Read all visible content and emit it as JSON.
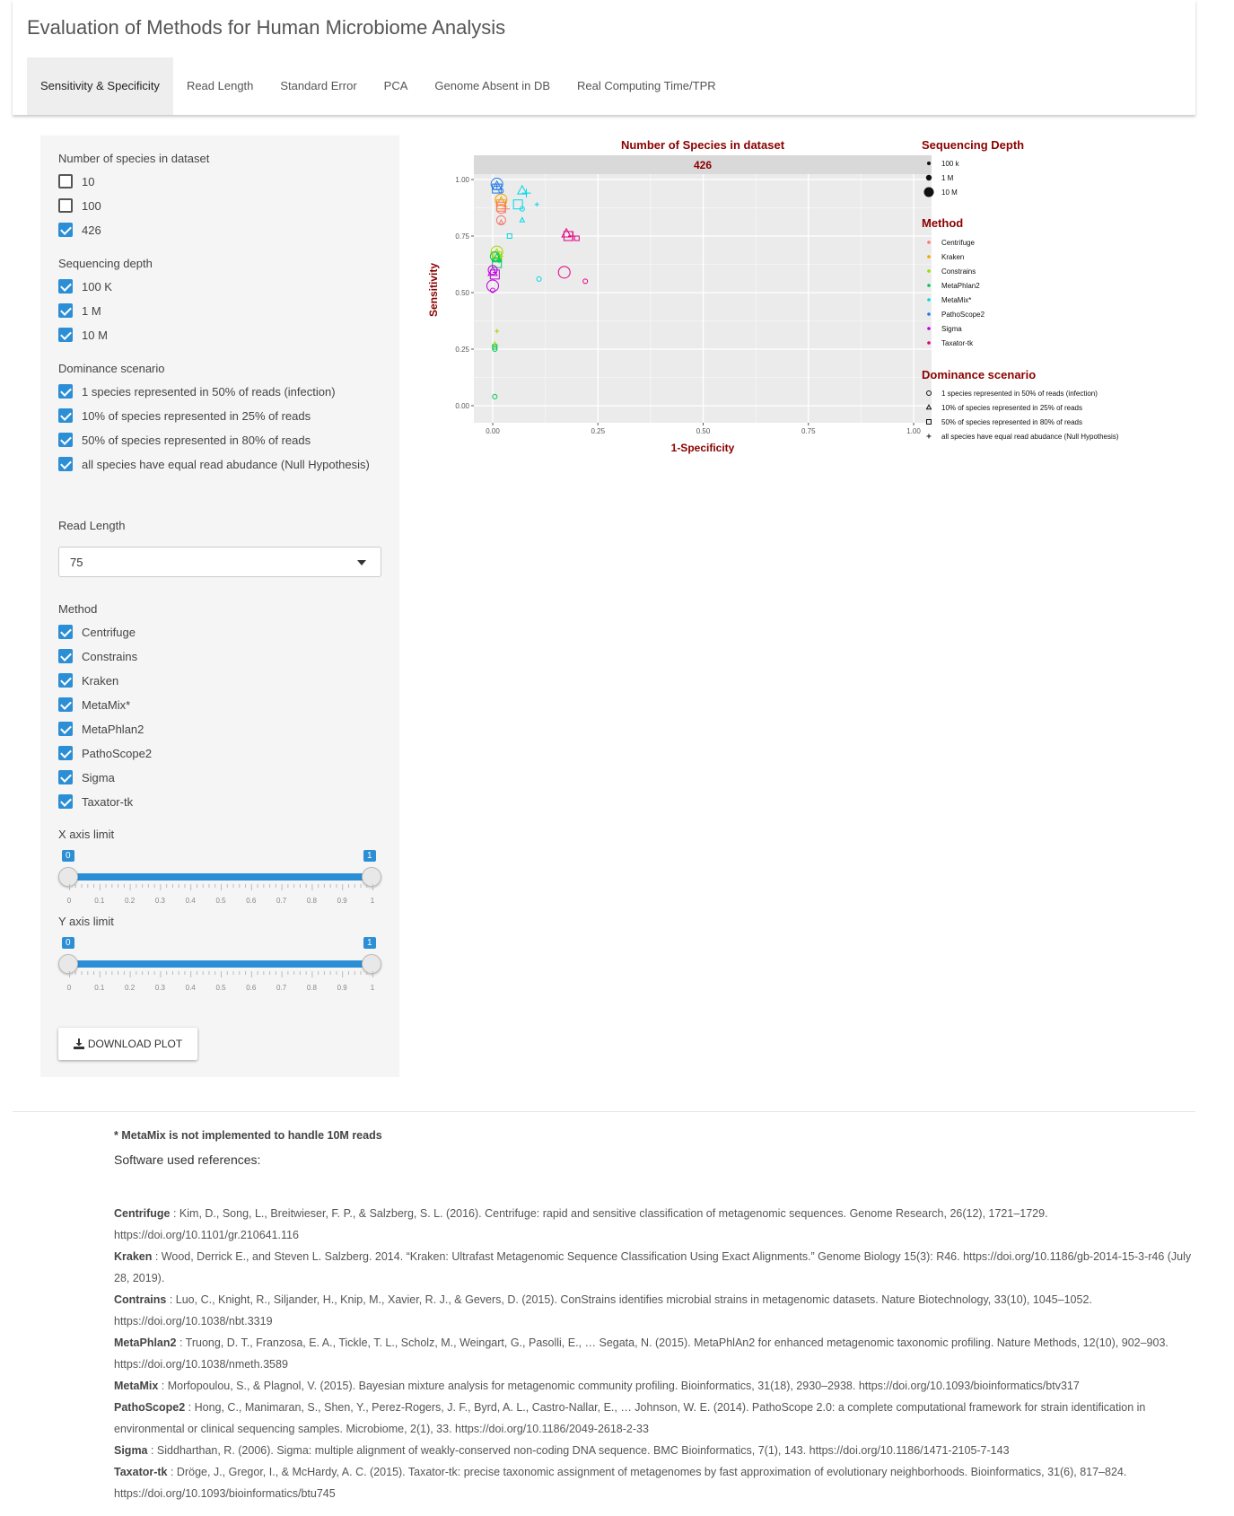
{
  "app": {
    "title": "Evaluation of Methods for Human Microbiome Analysis",
    "tabs": [
      {
        "label": "Sensitivity & Specificity",
        "active": true
      },
      {
        "label": "Read Length"
      },
      {
        "label": "Standard Error"
      },
      {
        "label": "PCA"
      },
      {
        "label": "Genome Absent in DB"
      },
      {
        "label": "Real Computing Time/TPR"
      }
    ]
  },
  "sidebar": {
    "species": {
      "label": "Number of species in dataset",
      "options": [
        {
          "label": "10",
          "checked": false
        },
        {
          "label": "100",
          "checked": false
        },
        {
          "label": "426",
          "checked": true
        }
      ]
    },
    "depth": {
      "label": "Sequencing depth",
      "options": [
        {
          "label": "100 K",
          "checked": true
        },
        {
          "label": "1 M",
          "checked": true
        },
        {
          "label": "10 M",
          "checked": true
        }
      ]
    },
    "dominance": {
      "label": "Dominance scenario",
      "options": [
        {
          "label": "1 species represented in 50% of reads (infection)",
          "checked": true
        },
        {
          "label": "10% of species represented in 25% of reads",
          "checked": true
        },
        {
          "label": "50% of species represented in 80% of reads",
          "checked": true
        },
        {
          "label": "all species have equal read abudance (Null Hypothesis)",
          "checked": true
        }
      ]
    },
    "read_length": {
      "label": "Read Length",
      "value": "75"
    },
    "method": {
      "label": "Method",
      "options": [
        {
          "label": "Centrifuge",
          "checked": true
        },
        {
          "label": "Constrains",
          "checked": true
        },
        {
          "label": "Kraken",
          "checked": true
        },
        {
          "label": "MetaMix*",
          "checked": true
        },
        {
          "label": "MetaPhlan2",
          "checked": true
        },
        {
          "label": "PathoScope2",
          "checked": true
        },
        {
          "label": "Sigma",
          "checked": true
        },
        {
          "label": "Taxator-tk",
          "checked": true
        }
      ]
    },
    "x_limit": {
      "label": "X axis limit",
      "min": "0",
      "max": "1",
      "ticks": [
        "0",
        "0.1",
        "0.2",
        "0.3",
        "0.4",
        "0.5",
        "0.6",
        "0.7",
        "0.8",
        "0.9",
        "1"
      ]
    },
    "y_limit": {
      "label": "Y axis limit",
      "min": "0",
      "max": "1",
      "ticks": [
        "0",
        "0.1",
        "0.2",
        "0.3",
        "0.4",
        "0.5",
        "0.6",
        "0.7",
        "0.8",
        "0.9",
        "1"
      ]
    },
    "download_label": "DOWNLOAD PLOT",
    "accent": "#2c8fd6"
  },
  "chart_data": {
    "type": "scatter",
    "title": "Number of Species in dataset",
    "facet_label": "426",
    "xlabel": "1-Specificity",
    "ylabel": "Sensitivity",
    "xlim": [
      0,
      1
    ],
    "ylim": [
      0,
      1
    ],
    "x_ticks": [
      "0.00",
      "0.25",
      "0.50",
      "0.75",
      "1.00"
    ],
    "y_ticks": [
      "0.00",
      "0.25",
      "0.50",
      "0.75",
      "1.00"
    ],
    "grid": true,
    "legend_position": "right",
    "legends": {
      "depth": {
        "title": "Sequencing Depth",
        "items": [
          "100 k",
          "1 M",
          "10 M"
        ]
      },
      "method": {
        "title": "Method",
        "items": [
          {
            "name": "Centrifuge",
            "color": "#f8766d"
          },
          {
            "name": "Kraken",
            "color": "#f5a300"
          },
          {
            "name": "Constrains",
            "color": "#a3d800"
          },
          {
            "name": "MetaPhlan2",
            "color": "#00c853"
          },
          {
            "name": "MetaMix*",
            "color": "#00d8e8"
          },
          {
            "name": "PathoScope2",
            "color": "#1e78e8"
          },
          {
            "name": "Sigma",
            "color": "#c000e0"
          },
          {
            "name": "Taxator-tk",
            "color": "#e0007f"
          }
        ]
      },
      "scenario": {
        "title": "Dominance scenario",
        "items": [
          {
            "name": "1 species represented in 50% of reads (infection)",
            "shape": "circle"
          },
          {
            "name": "10% of species represented in 25% of reads",
            "shape": "triangle"
          },
          {
            "name": "50% of species represented in 80% of reads",
            "shape": "square"
          },
          {
            "name": "all species have equal read abudance (Null Hypothesis)",
            "shape": "plus"
          }
        ]
      }
    },
    "points": [
      {
        "method": "PathoScope2",
        "shape": "circle",
        "size": 3,
        "x": 0.01,
        "y": 0.98
      },
      {
        "method": "PathoScope2",
        "shape": "triangle",
        "size": 2,
        "x": 0.01,
        "y": 0.97
      },
      {
        "method": "PathoScope2",
        "shape": "square",
        "size": 2,
        "x": 0.01,
        "y": 0.96
      },
      {
        "method": "PathoScope2",
        "shape": "plus",
        "size": 1,
        "x": 0.01,
        "y": 0.97
      },
      {
        "method": "PathoScope2",
        "shape": "circle",
        "size": 1,
        "x": 0.02,
        "y": 0.95
      },
      {
        "method": "Kraken",
        "shape": "circle",
        "size": 3,
        "x": 0.02,
        "y": 0.91
      },
      {
        "method": "Kraken",
        "shape": "triangle",
        "size": 2,
        "x": 0.02,
        "y": 0.9
      },
      {
        "method": "Kraken",
        "shape": "square",
        "size": 2,
        "x": 0.02,
        "y": 0.89
      },
      {
        "method": "Kraken",
        "shape": "plus",
        "size": 1,
        "x": 0.03,
        "y": 0.88
      },
      {
        "method": "Centrifuge",
        "shape": "circle",
        "size": 2,
        "x": 0.02,
        "y": 0.87
      },
      {
        "method": "Centrifuge",
        "shape": "square",
        "size": 2,
        "x": 0.02,
        "y": 0.88
      },
      {
        "method": "Centrifuge",
        "shape": "plus",
        "size": 2,
        "x": 0.03,
        "y": 0.87
      },
      {
        "method": "Centrifuge",
        "shape": "circle",
        "size": 2,
        "x": 0.02,
        "y": 0.82
      },
      {
        "method": "Centrifuge",
        "shape": "triangle",
        "size": 1,
        "x": 0.02,
        "y": 0.81
      },
      {
        "method": "MetaMix*",
        "shape": "triangle",
        "size": 2,
        "x": 0.07,
        "y": 0.95
      },
      {
        "method": "MetaMix*",
        "shape": "plus",
        "size": 2,
        "x": 0.08,
        "y": 0.94
      },
      {
        "method": "MetaMix*",
        "shape": "square",
        "size": 2,
        "x": 0.06,
        "y": 0.89
      },
      {
        "method": "MetaMix*",
        "shape": "circle",
        "size": 1,
        "x": 0.07,
        "y": 0.87
      },
      {
        "method": "MetaMix*",
        "shape": "plus",
        "size": 1,
        "x": 0.105,
        "y": 0.89
      },
      {
        "method": "MetaMix*",
        "shape": "triangle",
        "size": 1,
        "x": 0.07,
        "y": 0.82
      },
      {
        "method": "MetaMix*",
        "shape": "square",
        "size": 1,
        "x": 0.04,
        "y": 0.75
      },
      {
        "method": "MetaMix*",
        "shape": "circle",
        "size": 1,
        "x": 0.11,
        "y": 0.56
      },
      {
        "method": "Taxator-tk",
        "shape": "triangle",
        "size": 2,
        "x": 0.175,
        "y": 0.76
      },
      {
        "method": "Taxator-tk",
        "shape": "square",
        "size": 2,
        "x": 0.18,
        "y": 0.75
      },
      {
        "method": "Taxator-tk",
        "shape": "plus",
        "size": 2,
        "x": 0.19,
        "y": 0.75
      },
      {
        "method": "Taxator-tk",
        "shape": "square",
        "size": 1,
        "x": 0.2,
        "y": 0.74
      },
      {
        "method": "Taxator-tk",
        "shape": "circle",
        "size": 3,
        "x": 0.17,
        "y": 0.59
      },
      {
        "method": "Taxator-tk",
        "shape": "circle",
        "size": 1,
        "x": 0.22,
        "y": 0.55
      },
      {
        "method": "Constrains",
        "shape": "circle",
        "size": 3,
        "x": 0.01,
        "y": 0.68
      },
      {
        "method": "Constrains",
        "shape": "triangle",
        "size": 2,
        "x": 0.01,
        "y": 0.67
      },
      {
        "method": "Constrains",
        "shape": "square",
        "size": 2,
        "x": 0.01,
        "y": 0.66
      },
      {
        "method": "Constrains",
        "shape": "plus",
        "size": 1,
        "x": 0.02,
        "y": 0.66
      },
      {
        "method": "Constrains",
        "shape": "plus",
        "size": 1,
        "x": 0.01,
        "y": 0.33
      },
      {
        "method": "Constrains",
        "shape": "triangle",
        "size": 1,
        "x": 0.005,
        "y": 0.27
      },
      {
        "method": "MetaPhlan2",
        "shape": "circle",
        "size": 2,
        "x": 0.005,
        "y": 0.66
      },
      {
        "method": "MetaPhlan2",
        "shape": "triangle",
        "size": 2,
        "x": 0.01,
        "y": 0.65
      },
      {
        "method": "MetaPhlan2",
        "shape": "square",
        "size": 2,
        "x": 0.01,
        "y": 0.63
      },
      {
        "method": "MetaPhlan2",
        "shape": "plus",
        "size": 1,
        "x": 0.015,
        "y": 0.64
      },
      {
        "method": "MetaPhlan2",
        "shape": "square",
        "size": 1,
        "x": 0.005,
        "y": 0.26
      },
      {
        "method": "MetaPhlan2",
        "shape": "circle",
        "size": 1,
        "x": 0.005,
        "y": 0.25
      },
      {
        "method": "MetaPhlan2",
        "shape": "circle",
        "size": 1,
        "x": 0.005,
        "y": 0.04
      },
      {
        "method": "Sigma",
        "shape": "circle",
        "size": 2,
        "x": 0.0,
        "y": 0.6
      },
      {
        "method": "Sigma",
        "shape": "triangle",
        "size": 2,
        "x": 0.0,
        "y": 0.59
      },
      {
        "method": "Sigma",
        "shape": "square",
        "size": 2,
        "x": 0.005,
        "y": 0.58
      },
      {
        "method": "Sigma",
        "shape": "plus",
        "size": 1,
        "x": 0.005,
        "y": 0.59
      },
      {
        "method": "Sigma",
        "shape": "circle",
        "size": 3,
        "x": 0.0,
        "y": 0.53
      },
      {
        "method": "Sigma",
        "shape": "circle",
        "size": 1,
        "x": 0.0,
        "y": 0.51
      }
    ]
  },
  "footer": {
    "note": "* MetaMix is not implemented to handle 10M reads",
    "references_title": "Software used references:",
    "references": [
      {
        "name": "Centrifuge",
        "text": " : Kim, D., Song, L., Breitwieser, F. P., & Salzberg, S. L. (2016). Centrifuge: rapid and sensitive classification of metagenomic sequences. Genome Research, 26(12), 1721–1729. https://doi.org/10.1101/gr.210641.116"
      },
      {
        "name": "Kraken",
        "text": " : Wood, Derrick E., and Steven L. Salzberg. 2014. “Kraken: Ultrafast Metagenomic Sequence Classification Using Exact Alignments.” Genome Biology 15(3): R46. https://doi.org/10.1186/gb-2014-15-3-r46 (July 28, 2019)."
      },
      {
        "name": "Contrains",
        "text": " : Luo, C., Knight, R., Siljander, H., Knip, M., Xavier, R. J., & Gevers, D. (2015). ConStrains identifies microbial strains in metagenomic datasets. Nature Biotechnology, 33(10), 1045–1052. https://doi.org/10.1038/nbt.3319"
      },
      {
        "name": "MetaPhlan2",
        "text": " : Truong, D. T., Franzosa, E. A., Tickle, T. L., Scholz, M., Weingart, G., Pasolli, E., … Segata, N. (2015). MetaPhlAn2 for enhanced metagenomic taxonomic profiling. Nature Methods, 12(10), 902–903. https://doi.org/10.1038/nmeth.3589"
      },
      {
        "name": "MetaMix",
        "text": " : Morfopoulou, S., & Plagnol, V. (2015). Bayesian mixture analysis for metagenomic community profiling. Bioinformatics, 31(18), 2930–2938. https://doi.org/10.1093/bioinformatics/btv317"
      },
      {
        "name": "PathoScope2",
        "text": " : Hong, C., Manimaran, S., Shen, Y., Perez-Rogers, J. F., Byrd, A. L., Castro-Nallar, E., … Johnson, W. E. (2014). PathoScope 2.0: a complete computational framework for strain identification in environmental or clinical sequencing samples. Microbiome, 2(1), 33. https://doi.org/10.1186/2049-2618-2-33"
      },
      {
        "name": "Sigma",
        "text": " : Siddharthan, R. (2006). Sigma: multiple alignment of weakly-conserved non-coding DNA sequence. BMC Bioinformatics, 7(1), 143. https://doi.org/10.1186/1471-2105-7-143"
      },
      {
        "name": "Taxator-tk",
        "text": " : Dröge, J., Gregor, I., & McHardy, A. C. (2015). Taxator-tk: precise taxonomic assignment of metagenomes by fast approximation of evolutionary neighborhoods. Bioinformatics, 31(6), 817–824. https://doi.org/10.1093/bioinformatics/btu745"
      }
    ]
  }
}
